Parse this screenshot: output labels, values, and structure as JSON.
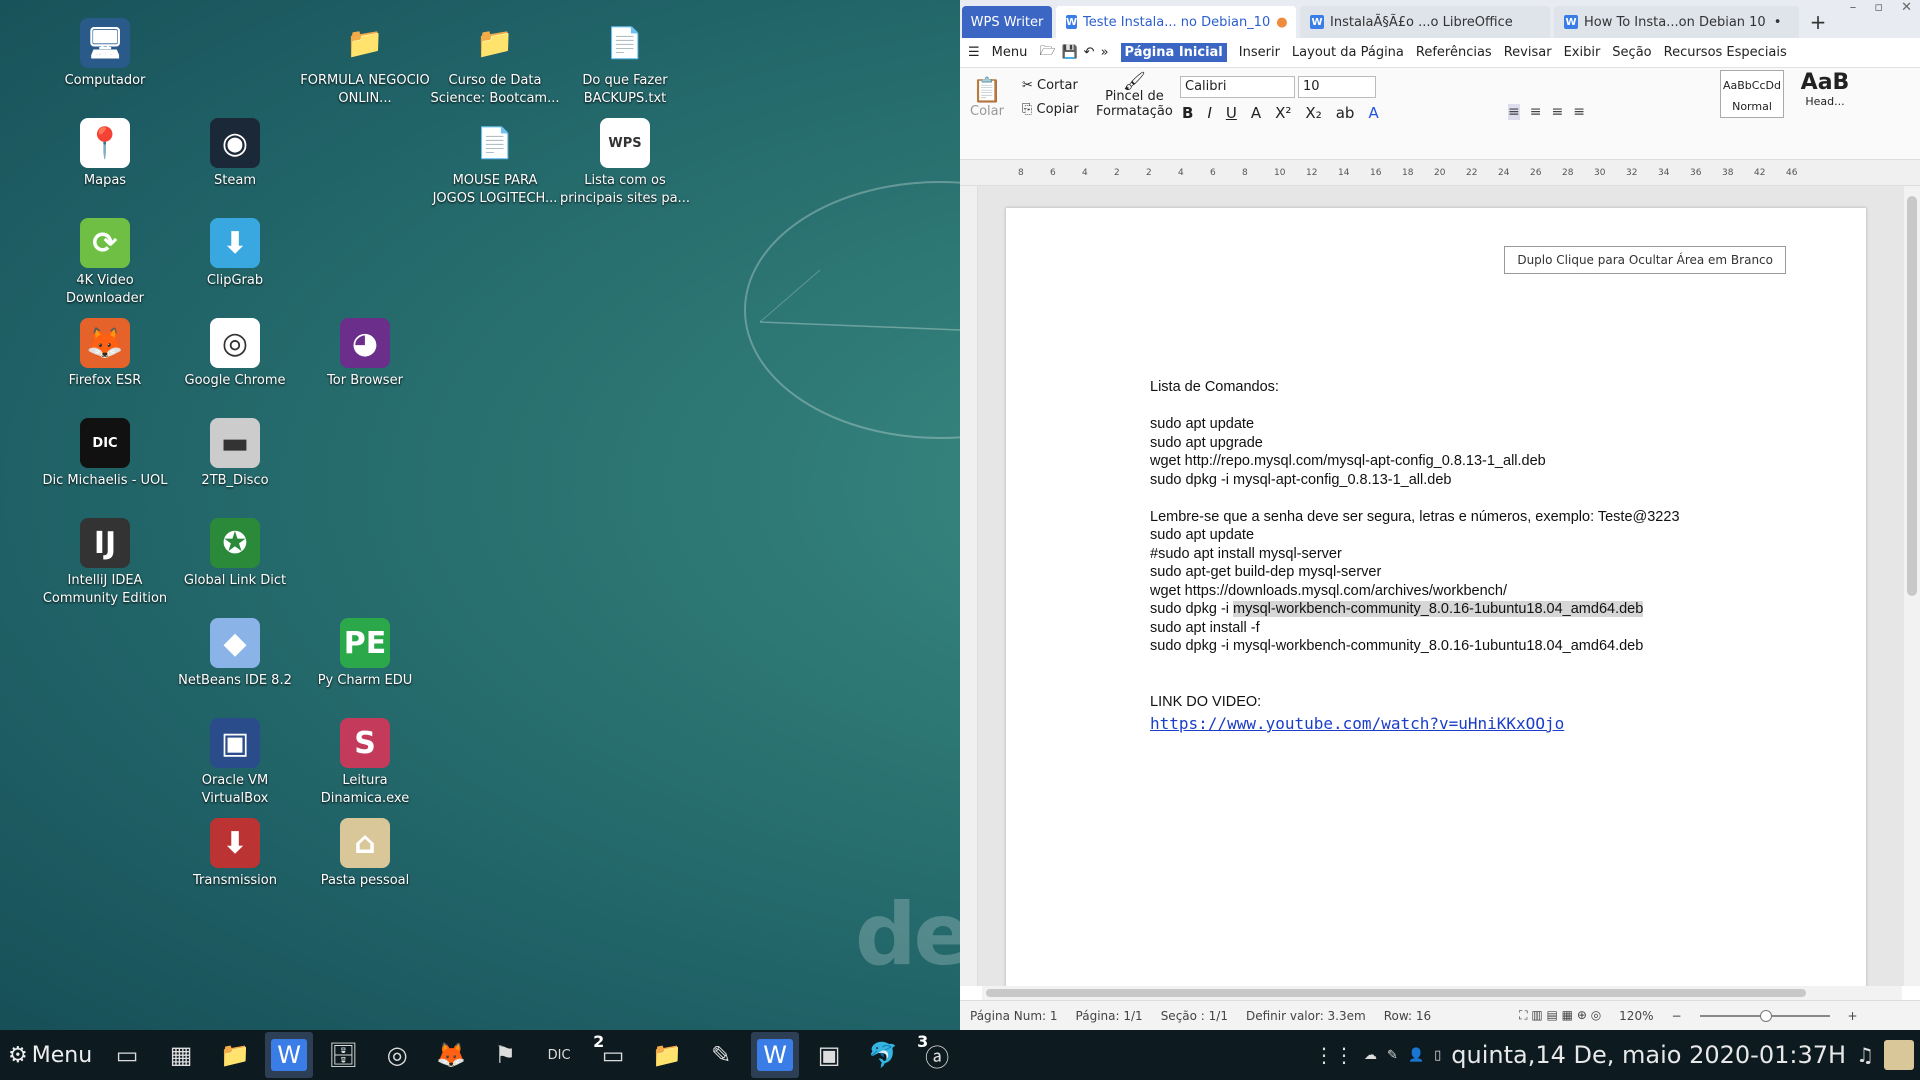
{
  "desktop": {
    "icons": [
      {
        "label": "Computador",
        "icon": "computer-icon"
      },
      {
        "label": "Mapas",
        "icon": "map-icon"
      },
      {
        "label": "4K Video Downloader",
        "icon": "4k-video-downloader-icon"
      },
      {
        "label": "Firefox ESR",
        "icon": "firefox-icon"
      },
      {
        "label": "Dic Michaelis - UOL",
        "icon": "dic-icon"
      },
      {
        "label": "IntelliJ IDEA Community Edition",
        "icon": "intellij-icon"
      },
      {
        "label": "Steam",
        "icon": "steam-icon"
      },
      {
        "label": "ClipGrab",
        "icon": "clipgrab-icon"
      },
      {
        "label": "Google Chrome",
        "icon": "chrome-icon"
      },
      {
        "label": "2TB_Disco",
        "icon": "disk-icon"
      },
      {
        "label": "Global Link Dict",
        "icon": "translator-icon"
      },
      {
        "label": "NetBeans IDE 8.2",
        "icon": "netbeans-icon"
      },
      {
        "label": "Oracle VM VirtualBox",
        "icon": "virtualbox-icon"
      },
      {
        "label": "Transmission",
        "icon": "transmission-icon"
      },
      {
        "label": "FORMULA NEGOCIO ONLIN...",
        "icon": "folder-icon"
      },
      {
        "label": "Tor Browser",
        "icon": "tor-browser-icon"
      },
      {
        "label": "Py Charm EDU",
        "icon": "pycharm-icon"
      },
      {
        "label": "Leitura Dinamica.exe",
        "icon": "speed-reading-icon"
      },
      {
        "label": "Pasta pessoal",
        "icon": "home-folder-icon"
      },
      {
        "label": "Curso de Data Science: Bootcam...",
        "icon": "folder-icon"
      },
      {
        "label": "MOUSE PARA JOGOS LOGITECH...",
        "icon": "text-file-icon"
      },
      {
        "label": "Do que Fazer BACKUPS.txt",
        "icon": "text-file-icon"
      },
      {
        "label": "Lista com os principais sites pa...",
        "icon": "wps-file-icon"
      }
    ],
    "wallpaper_text": "deb"
  },
  "window": {
    "tabs": [
      {
        "label": "WPS Writer"
      },
      {
        "label": "Teste Instala... no Debian_10"
      },
      {
        "label": "InstalaÃ§Ã£o ...o LibreOffice"
      },
      {
        "label": "How To Insta...on Debian 10"
      }
    ],
    "new_tab": "+",
    "menu": [
      "Menu",
      "Página Inicial",
      "Inserir",
      "Layout da Página",
      "Referências",
      "Revisar",
      "Exibir",
      "Seção",
      "Recursos Especiais"
    ],
    "toolbar": {
      "colar": "Colar",
      "cortar": "Cortar",
      "copiar": "Copiar",
      "pincel": "Pincel de",
      "formatacao": "Formatação",
      "font": "Calibri",
      "size": "10",
      "style_normal": "Normal",
      "style_head": "Head...",
      "style_preview": "AaBbCcDd",
      "style_big": "AaB"
    },
    "hint": "Duplo Clique para Ocultar Área em Branco",
    "ruler_nums": [
      "8",
      "6",
      "4",
      "2",
      "2",
      "4",
      "6",
      "8",
      "10",
      "12",
      "14",
      "16",
      "18",
      "20",
      "22",
      "24",
      "26",
      "28",
      "30",
      "32",
      "34",
      "36",
      "38",
      "42",
      "46"
    ],
    "document": [
      "Lista de Comandos:",
      "",
      "sudo apt update",
      "sudo apt upgrade",
      "wget http://repo.mysql.com/mysql-apt-config_0.8.13-1_all.deb",
      "sudo dpkg -i mysql-apt-config_0.8.13-1_all.deb",
      "",
      "Lembre-se que a senha deve ser segura, letras e números, exemplo: Teste@3223",
      "sudo apt update",
      "#sudo apt install mysql-server",
      "sudo apt-get build-dep mysql-server",
      "wget https://downloads.mysql.com/archives/workbench/",
      "sudo dpkg -i ",
      "sudo apt install -f",
      "sudo dpkg -i mysql-workbench-community_8.0.16-1ubuntu18.04_amd64.deb",
      "",
      "",
      "LINK DO VIDEO:"
    ],
    "highlighted": "mysql-workbench-community_8.0.16-1ubuntu18.04_amd64.deb",
    "link": "https://www.youtube.com/watch?v=uHniKKxOOjo",
    "status": [
      "Página Num: 1",
      "Página: 1/1",
      "Seção : 1/1",
      "Definir valor: 3.3em",
      "Row: 16"
    ],
    "zoom": "120%"
  },
  "taskbar": {
    "menu_label": "Menu",
    "clock": "quinta,14 De, maio 2020-01:37H",
    "apps": [
      "terminal-icon",
      "calculator-icon",
      "folder-icon",
      "wps-icon",
      "files-icon",
      "chrome-icon",
      "firefox-icon",
      "flag-icon",
      "dic-icon",
      "terminal-icon",
      "folder-icon",
      "paint-icon",
      "wps-icon",
      "virtualbox-icon",
      "mysql-workbench-icon",
      "a-icon"
    ],
    "badges": {
      "9": "2",
      "15": "3"
    }
  }
}
